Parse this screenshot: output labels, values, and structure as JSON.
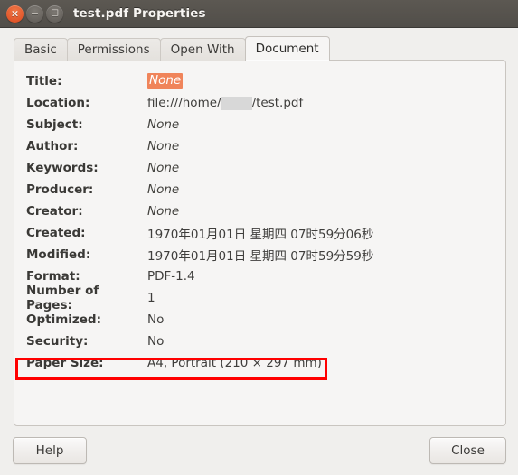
{
  "window": {
    "title": "test.pdf Properties",
    "controls": [
      {
        "name": "close",
        "glyph": "×"
      },
      {
        "name": "minimize",
        "glyph": "−"
      },
      {
        "name": "maximize",
        "glyph": "□"
      }
    ]
  },
  "tabs": [
    {
      "label": "Basic",
      "active": false
    },
    {
      "label": "Permissions",
      "active": false
    },
    {
      "label": "Open With",
      "active": false
    },
    {
      "label": "Document",
      "active": true
    }
  ],
  "document_properties": [
    {
      "label": "Title:",
      "value": "None",
      "style": "none-highlighted"
    },
    {
      "label": "Location:",
      "value": "file:///home/",
      "value_suffix": "/test.pdf",
      "style": "redacted"
    },
    {
      "label": "Subject:",
      "value": "None",
      "style": "none"
    },
    {
      "label": "Author:",
      "value": "None",
      "style": "none"
    },
    {
      "label": "Keywords:",
      "value": "None",
      "style": "none"
    },
    {
      "label": "Producer:",
      "value": "None",
      "style": "none"
    },
    {
      "label": "Creator:",
      "value": "None",
      "style": "none"
    },
    {
      "label": "Created:",
      "value": "1970年01月01日 星期四 07时59分06秒",
      "style": "plain"
    },
    {
      "label": "Modified:",
      "value": "1970年01月01日 星期四 07时59分59秒",
      "style": "plain"
    },
    {
      "label": "Format:",
      "value": "PDF-1.4",
      "style": "plain"
    },
    {
      "label": "Number of Pages:",
      "value": "1",
      "style": "plain"
    },
    {
      "label": "Optimized:",
      "value": "No",
      "style": "plain"
    },
    {
      "label": "Security:",
      "value": "No",
      "style": "plain"
    },
    {
      "label": "Paper Size:",
      "value": "A4, Portrait (210 × 297 mm)",
      "style": "plain"
    }
  ],
  "annotation": {
    "target_row": "Paper Size:",
    "color": "#ff0000",
    "shape": "rectangle"
  },
  "footer": {
    "help_label": "Help",
    "close_label": "Close"
  },
  "colors": {
    "titlebar": "#514e49",
    "window_bg": "#f0efed",
    "panel_bg": "#f6f5f4",
    "highlight": "#f0845a",
    "annotation": "#ff0000",
    "redaction": "#d8d8d8"
  }
}
